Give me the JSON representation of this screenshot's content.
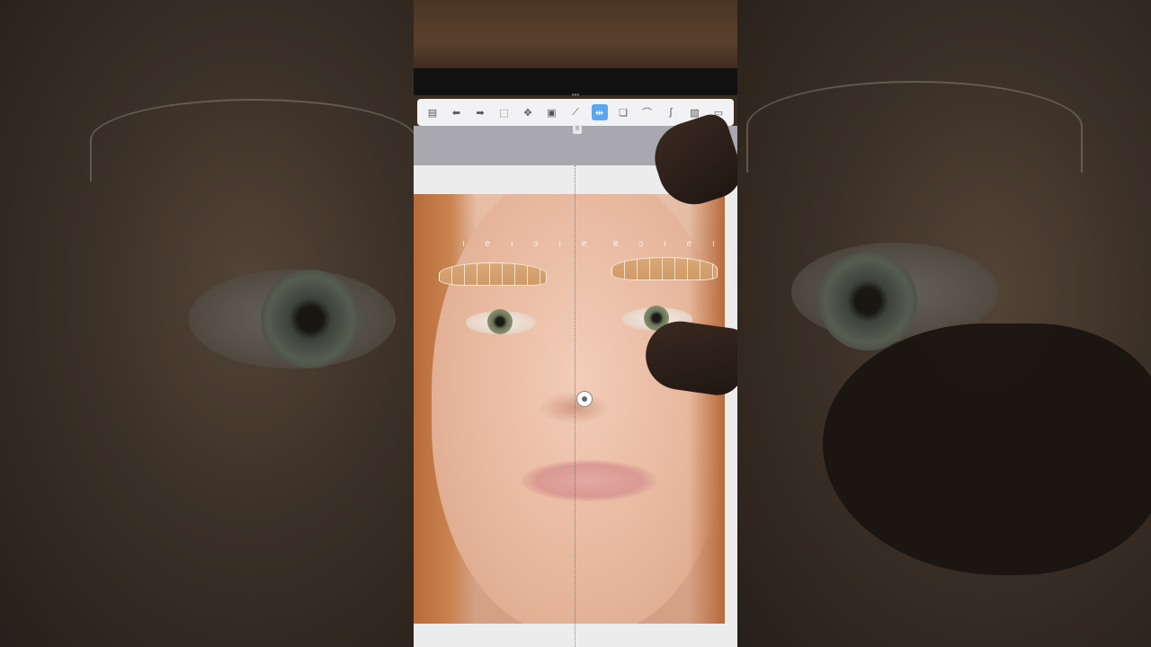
{
  "toolbar": {
    "tools": [
      {
        "name": "menu-icon",
        "glyph": "▤"
      },
      {
        "name": "undo-icon",
        "glyph": "⬅"
      },
      {
        "name": "redo-icon",
        "glyph": "➡"
      },
      {
        "name": "selection-icon",
        "glyph": "⬚"
      },
      {
        "name": "move-icon",
        "glyph": "✥"
      },
      {
        "name": "canvas-icon",
        "glyph": "▣"
      },
      {
        "name": "ruler-icon",
        "glyph": "⟋"
      },
      {
        "name": "symmetry-icon",
        "glyph": "⇹",
        "active": true
      },
      {
        "name": "layers-icon",
        "glyph": "❏"
      },
      {
        "name": "curve-icon",
        "glyph": "⌒"
      },
      {
        "name": "pen-icon",
        "glyph": "ʃ"
      },
      {
        "name": "image-icon",
        "glyph": "▨"
      },
      {
        "name": "settings-icon",
        "glyph": "▭"
      }
    ],
    "active_color": "#5ba6f2"
  },
  "mini_button": "II",
  "brow_marks": {
    "left": "ı e ı ɔ ı e",
    "right": "ɐ ɔ ı e ı"
  }
}
